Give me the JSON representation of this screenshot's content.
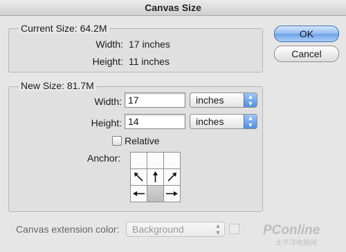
{
  "window": {
    "title": "Canvas Size"
  },
  "buttons": {
    "ok": "OK",
    "cancel": "Cancel"
  },
  "current_size": {
    "heading": "Current Size: 64.2M",
    "width_label": "Width:",
    "width_value": "17 inches",
    "height_label": "Height:",
    "height_value": "11 inches"
  },
  "new_size": {
    "heading": "New Size: 81.7M",
    "width_label": "Width:",
    "width_value": "17",
    "width_unit": "inches",
    "height_label": "Height:",
    "height_value": "14",
    "height_unit": "inches",
    "relative_label": "Relative",
    "relative_checked": false,
    "anchor_label": "Anchor:",
    "anchor_position": "bottom-center"
  },
  "extension": {
    "label": "Canvas extension color:",
    "value": "Background"
  },
  "watermark": {
    "brand": "PConline",
    "subtitle": "太平洋电脑网"
  }
}
